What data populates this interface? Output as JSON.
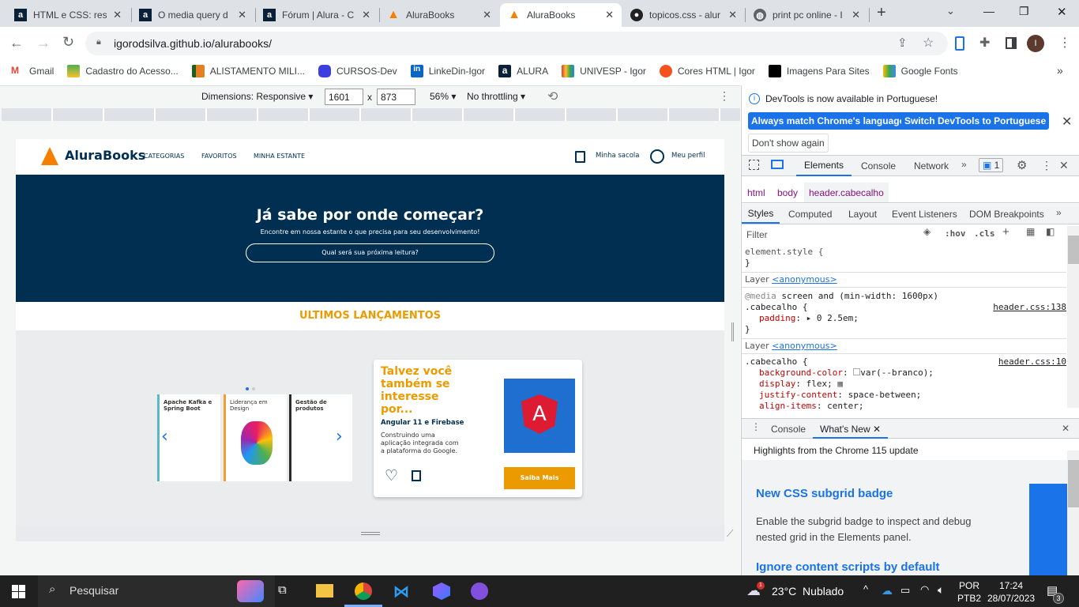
{
  "browser": {
    "tabs": [
      {
        "title": "HTML e CSS: resp",
        "icon": "alura-icon"
      },
      {
        "title": "O media query d",
        "icon": "alura-icon"
      },
      {
        "title": "Fórum | Alura - C",
        "icon": "alura-icon"
      },
      {
        "title": "AluraBooks",
        "icon": "alurabooks-icon"
      },
      {
        "title": "AluraBooks",
        "icon": "alurabooks-icon",
        "active": true
      },
      {
        "title": "topicos.css - alur",
        "icon": "github-icon"
      },
      {
        "title": "print pc online - I",
        "icon": "globe-icon"
      }
    ],
    "url": "igorodsilva.github.io/alurabooks/",
    "profile_initial": "I",
    "bookmarks": [
      "Gmail",
      "Cadastro do Acesso...",
      "ALISTAMENTO MILI...",
      "CURSOS-Dev",
      "LinkeDin-Igor",
      "ALURA",
      "UNIVESP - Igor",
      "Cores HTML | Igor",
      "Imagens Para Sites",
      "Google Fonts"
    ]
  },
  "device_toolbar": {
    "dimensions": "Dimensions: Responsive",
    "width": "1601",
    "times": "x",
    "height": "873",
    "zoom": "56%",
    "throttling": "No throttling"
  },
  "site": {
    "logo": "AluraBooks",
    "nav": [
      "CATEGORIAS",
      "FAVORITOS",
      "MINHA ESTANTE"
    ],
    "bag": "Minha sacola",
    "profile": "Meu perfil",
    "banner_title": "Já sabe por onde começar?",
    "banner_subtitle": "Encontre em nossa estante o que precisa para seu desenvolvimento!",
    "search_placeholder": "Qual será sua próxima leitura?",
    "section_title": "ULTIMOS LANÇAMENTOS",
    "books": [
      {
        "title": "Apache Kafka e Spring Boot",
        "color": "#5bb8c4"
      },
      {
        "title": "Liderança em Design",
        "color": "#f0a030"
      },
      {
        "title": "Gestão de produtos",
        "color": "#2b2b2b"
      }
    ],
    "card": {
      "heading": "Talvez você também se interesse por...",
      "book_title": "Angular 11 e Firebase",
      "description": "Construindo uma aplicação integrada com a plataforma do Google.",
      "button": "Saiba Mais"
    },
    "colors": {
      "navy": "#002f52",
      "orange": "#eb9b00"
    }
  },
  "devtools": {
    "notice": "DevTools is now available in Portuguese!",
    "btn_match": "Always match Chrome's language",
    "btn_switch": "Switch DevTools to Portuguese",
    "btn_dont": "Don't show again",
    "tabs": [
      "Elements",
      "Console",
      "Network"
    ],
    "issues_count": "1",
    "breadcrumbs": [
      "html",
      "body",
      "header.cabecalho"
    ],
    "subtabs": [
      "Styles",
      "Computed",
      "Layout",
      "Event Listeners",
      "DOM Breakpoints"
    ],
    "filter_placeholder": "Filter",
    "hov": ":hov",
    "cls": ".cls",
    "element_style": "element.style {",
    "close_brace": "}",
    "layer": "Layer",
    "anonymous": "<anonymous>",
    "media": "@media",
    "media_rest": "screen and (min-width: 1600px)",
    "selector": ".cabecalho {",
    "src1": "header.css:138",
    "src2": "header.css:10",
    "rule1": [
      {
        "prop": "padding",
        "val": "0 2.5em;"
      }
    ],
    "rule2": [
      {
        "prop": "background-color",
        "val": "var(--branco);"
      },
      {
        "prop": "display",
        "val": "flex;"
      },
      {
        "prop": "justify-content",
        "val": "space-between;"
      },
      {
        "prop": "align-items",
        "val": "center;"
      }
    ],
    "drawer_tabs": [
      "Console",
      "What's New"
    ],
    "highlights": "Highlights from the Chrome 115 update",
    "news": [
      {
        "title": "New CSS subgrid badge",
        "body": "Enable the subgrid badge to inspect and debug nested grid in the Elements panel."
      },
      {
        "title": "Ignore content scripts by default",
        "body": ""
      }
    ]
  },
  "taskbar": {
    "search": "Pesquisar",
    "weather": "23°C  Nublado",
    "weather_badge": "1",
    "lang1": "POR",
    "lang2": "PTB2",
    "time": "17:24",
    "date": "28/07/2023",
    "notifications": "3"
  }
}
